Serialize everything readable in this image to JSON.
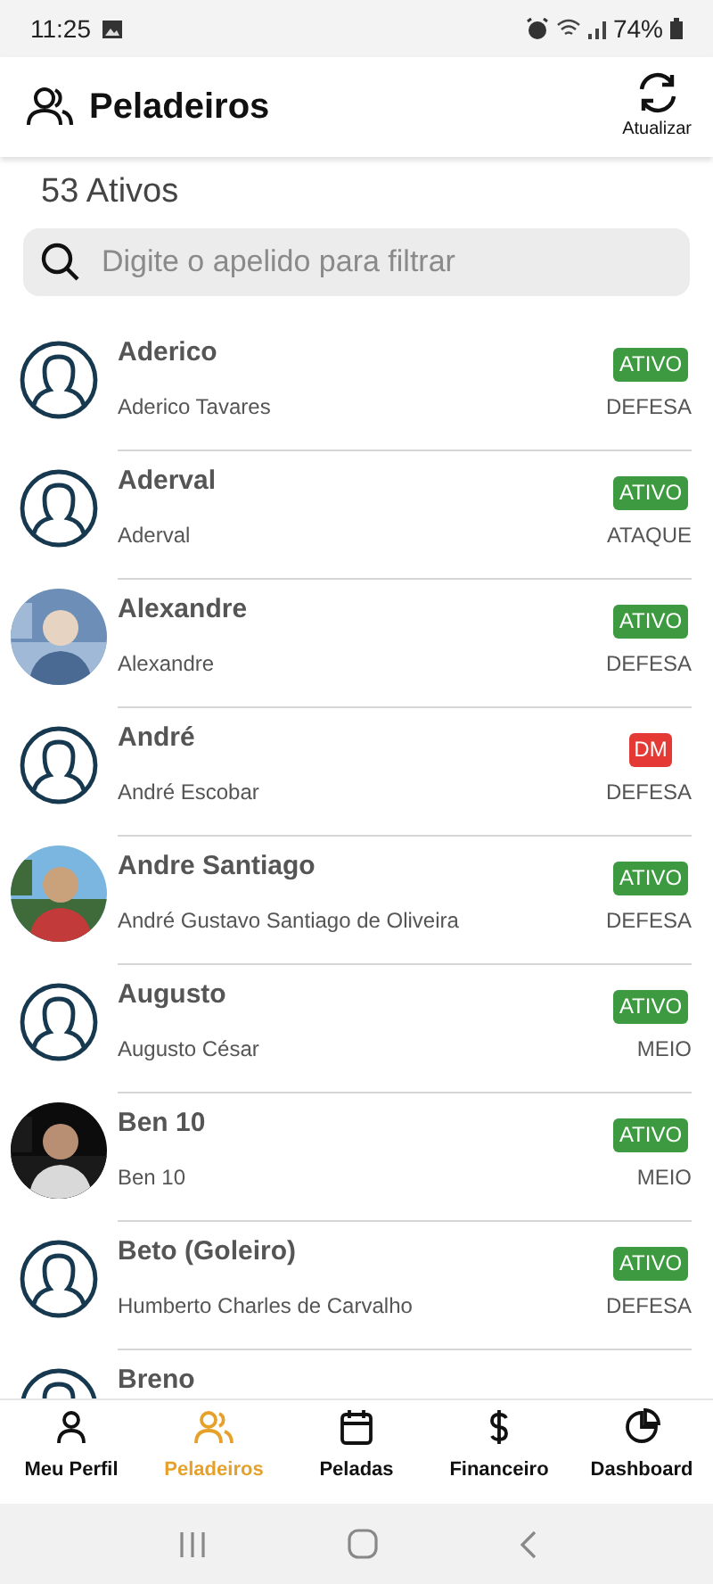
{
  "status_bar": {
    "time": "11:25",
    "battery": "74%"
  },
  "header": {
    "title": "Peladeiros",
    "refresh_label": "Atualizar"
  },
  "count": "53 Ativos",
  "search": {
    "placeholder": "Digite o apelido para filtrar"
  },
  "players": [
    {
      "nickname": "Aderico",
      "full_name": "Aderico Tavares",
      "status": "ATIVO",
      "color": "#3d9a40",
      "position": "DEFESA",
      "kind": "placeholder"
    },
    {
      "nickname": "Aderval",
      "full_name": "Aderval",
      "status": "ATIVO",
      "color": "#3d9a40",
      "position": "ATAQUE",
      "kind": "placeholder"
    },
    {
      "nickname": "Alexandre",
      "full_name": "Alexandre",
      "status": "ATIVO",
      "color": "#3d9a40",
      "position": "DEFESA"
    },
    {
      "nickname": "André",
      "full_name": "André Escobar",
      "status": "DM",
      "color": "#e53935",
      "position": "DEFESA",
      "kind": "placeholder"
    },
    {
      "nickname": "Andre Santiago",
      "full_name": "André Gustavo Santiago de Oliveira",
      "status": "ATIVO",
      "color": "#3d9a40",
      "position": "DEFESA"
    },
    {
      "nickname": "Augusto",
      "full_name": "Augusto César",
      "status": "ATIVO",
      "color": "#3d9a40",
      "position": "MEIO",
      "kind": "placeholder"
    },
    {
      "nickname": "Ben 10",
      "full_name": "Ben 10",
      "status": "ATIVO",
      "color": "#3d9a40",
      "position": "MEIO"
    },
    {
      "nickname": "Beto (Goleiro)",
      "full_name": "Humberto Charles de Carvalho",
      "status": "ATIVO",
      "color": "#3d9a40",
      "position": "DEFESA",
      "kind": "placeholder"
    },
    {
      "nickname": "Breno",
      "kind": "placeholder"
    }
  ],
  "bottom_nav": [
    {
      "label": "Meu Perfil",
      "selected": false
    },
    {
      "label": "Peladeiros",
      "selected": true
    },
    {
      "label": "Peladas",
      "selected": false
    },
    {
      "label": "Financeiro",
      "selected": false
    },
    {
      "label": "Dashboard",
      "selected": false
    }
  ]
}
